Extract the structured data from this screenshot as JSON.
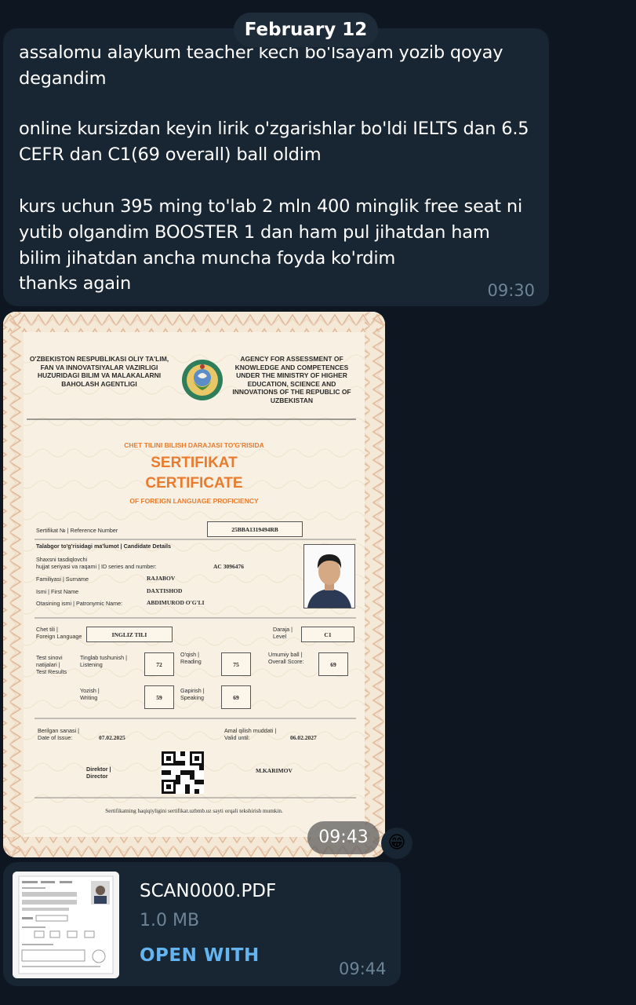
{
  "date_separator": "February 12",
  "message": {
    "lines": [
      "assalomu alaykum teacher kech bo'lsayam yozib qoyay",
      "degandim",
      "online kursizdan keyin lirik o'zgarishlar bo'ldi IELTS dan 6.5",
      "CEFR dan C1(69 overall) ball oldim",
      "kurs uchun 395 ming to'lab 2 mln 400 minglik free seat ni",
      "yutib olgandim BOOSTER 1 dan ham pul jihatdan ham",
      "bilim jihatdan ancha muncha foyda ko'rdim",
      "thanks again"
    ],
    "time": "09:30"
  },
  "certificate": {
    "header_left": "O'ZBEKISTON RESPUBLIKASI OLIY TA'LIM, FAN VA INNOVATSIYALAR VAZIRLIGI HUZURIDAGI BILIM VA MALAKALARNI BAHOLASH AGENTLIGI",
    "header_right": "AGENCY FOR ASSESSMENT OF KNOWLEDGE AND COMPETENCES UNDER THE MINISTRY OF HIGHER EDUCATION, SCIENCE AND INNOVATIONS OF THE REPUBLIC OF UZBEKISTAN",
    "subtitle_top": "CHET TILINI BILISH DARAJASI TO'G'RISIDA",
    "title_uz": "SERTIFIKAT",
    "title_en": "CERTIFICATE",
    "subtitle_bottom": "OF FOREIGN LANGUAGE PROFICIENCY",
    "ref_label": "Sertifikat № | Reference Number",
    "ref_value": "25BBA1319494RB",
    "candidate_label": "Talabgor to'g'risidagi ma'lumot | Candidate Details",
    "id_label_1": "Shaxsni tasdiqlovchi",
    "id_label_2": "hujjat seriyasi va raqami | ID series and number:",
    "id_value": "AC 3096476",
    "surname_label": "Familiyasi | Surname",
    "surname_value": "RAJABOV",
    "first_label": "Ismi | First Name",
    "first_value": "DAXTISHOD",
    "patronymic_label": "Otasining ismi | Patronymic Name:",
    "patronymic_value": "ABDIMUROD O'G'LI",
    "lang_label_1": "Chet tili |",
    "lang_label_2": "Foreign Language",
    "lang_value": "INGLIZ TILI",
    "level_label_1": "Daraja |",
    "level_label_2": "Level",
    "level_value": "C1",
    "results_label_1": "Test sinovi",
    "results_label_2": "natijalari |",
    "results_label_3": "Test Results",
    "listening_label_1": "Tinglab tushunish |",
    "listening_label_2": "Listening",
    "listening_value": "72",
    "reading_label_1": "O'qish |",
    "reading_label_2": "Reading",
    "reading_value": "75",
    "overall_label_1": "Umumiy ball |",
    "overall_label_2": "Overall Score:",
    "overall_value": "69",
    "writing_label_1": "Yozish |",
    "writing_label_2": "Writing",
    "writing_value": "59",
    "speaking_label_1": "Gapirish |",
    "speaking_label_2": "Speaking",
    "speaking_value": "69",
    "issue_label_1": "Berilgan sanasi |",
    "issue_label_2": "Date of Issue:",
    "issue_value": "07.02.2025",
    "valid_label_1": "Amal qilish muddati |",
    "valid_label_2": "Valid until:",
    "valid_value": "06.02.2027",
    "director_label_1": "Direktor |",
    "director_label_2": "Director",
    "director_name": "M.KARIMOV",
    "footer": "Sertifikatning haqiqiyligini sertifikat.uzbmb.uz sayti orqali tekshirish mumkin."
  },
  "photo_time": "09:43",
  "reaction_emoji": "😁",
  "file": {
    "name": "SCAN0000.PDF",
    "size": "1.0 MB",
    "action": "OPEN WITH",
    "time": "09:44"
  },
  "colors": {
    "background": "#0e1621",
    "bubble": "#182533",
    "accent": "#64b5ef",
    "cert_orange": "#e87b2e"
  }
}
